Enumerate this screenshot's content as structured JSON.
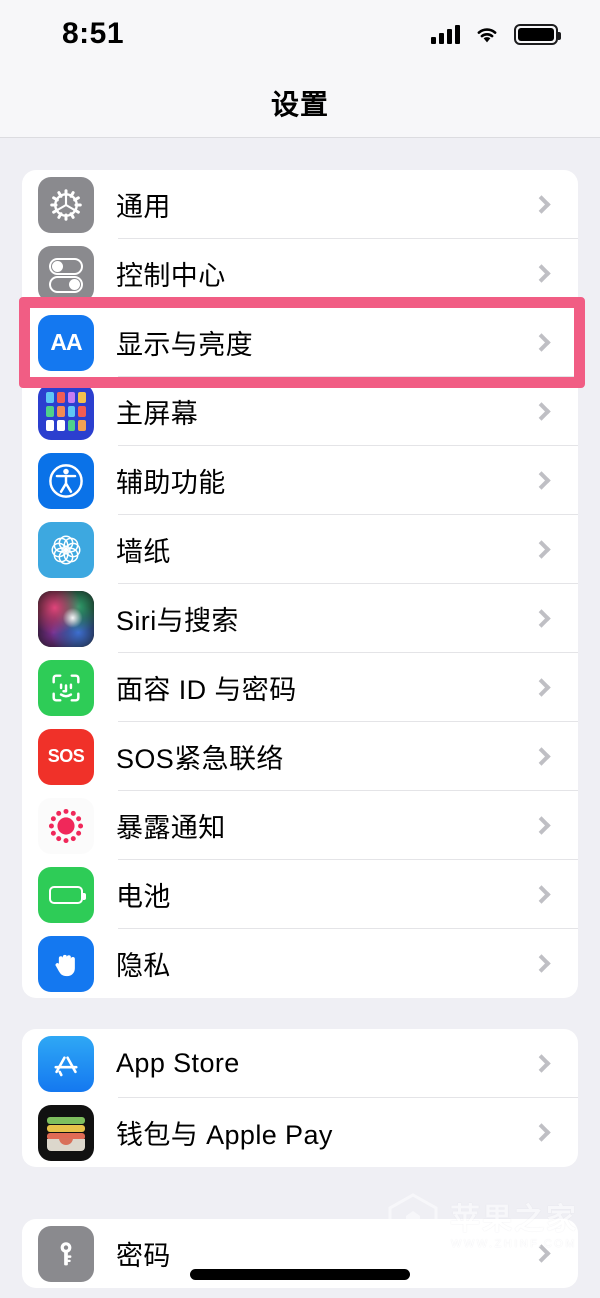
{
  "status_bar": {
    "time": "8:51",
    "signal_icon": "cellular-bars-icon",
    "wifi_icon": "wifi-icon",
    "battery_icon": "battery-full-icon"
  },
  "nav": {
    "title": "设置"
  },
  "highlight": {
    "color": "#F15D84",
    "target_label": "显示与亮度"
  },
  "groups": [
    {
      "id": "system",
      "rows": [
        {
          "label": "通用",
          "icon": "gear-icon",
          "icon_style": "ic-general",
          "chevron": "chevron-right-icon"
        },
        {
          "label": "控制中心",
          "icon": "control-center-icon",
          "icon_style": "ic-control",
          "chevron": "chevron-right-icon"
        },
        {
          "label": "显示与亮度",
          "icon": "display-brightness-icon",
          "icon_style": "ic-display",
          "icon_text": "AA",
          "chevron": "chevron-right-icon"
        },
        {
          "label": "主屏幕",
          "icon": "home-screen-icon",
          "icon_style": "ic-home",
          "chevron": "chevron-right-icon"
        },
        {
          "label": "辅助功能",
          "icon": "accessibility-icon",
          "icon_style": "ic-access",
          "chevron": "chevron-right-icon"
        },
        {
          "label": "墙纸",
          "icon": "wallpaper-icon",
          "icon_style": "ic-wallpaper",
          "chevron": "chevron-right-icon"
        },
        {
          "label": "Siri与搜索",
          "icon": "siri-icon",
          "icon_style": "ic-siri",
          "chevron": "chevron-right-icon"
        },
        {
          "label": "面容 ID 与密码",
          "icon": "face-id-icon",
          "icon_style": "ic-faceid",
          "chevron": "chevron-right-icon"
        },
        {
          "label": "SOS紧急联络",
          "icon": "emergency-sos-icon",
          "icon_style": "ic-sos",
          "icon_text": "SOS",
          "chevron": "chevron-right-icon"
        },
        {
          "label": "暴露通知",
          "icon": "exposure-notifications-icon",
          "icon_style": "ic-exposure",
          "chevron": "chevron-right-icon"
        },
        {
          "label": "电池",
          "icon": "battery-icon",
          "icon_style": "ic-battery",
          "chevron": "chevron-right-icon"
        },
        {
          "label": "隐私",
          "icon": "privacy-hand-icon",
          "icon_style": "ic-privacy",
          "chevron": "chevron-right-icon"
        }
      ]
    },
    {
      "id": "store",
      "rows": [
        {
          "label": "App Store",
          "icon": "app-store-icon",
          "icon_style": "ic-appstore",
          "chevron": "chevron-right-icon"
        },
        {
          "label": "钱包与 Apple Pay",
          "icon": "wallet-icon",
          "icon_style": "ic-wallet",
          "chevron": "chevron-right-icon"
        }
      ]
    },
    {
      "id": "accounts",
      "rows": [
        {
          "label": "密码",
          "icon": "key-icon",
          "icon_style": "ic-passwords",
          "chevron": "chevron-right-icon"
        }
      ]
    }
  ],
  "watermark": {
    "title": "苹果之家",
    "url": "WWW.ZHINF.COM",
    "logo_icon": "house-logo-icon"
  },
  "home_indicator": "home-indicator"
}
